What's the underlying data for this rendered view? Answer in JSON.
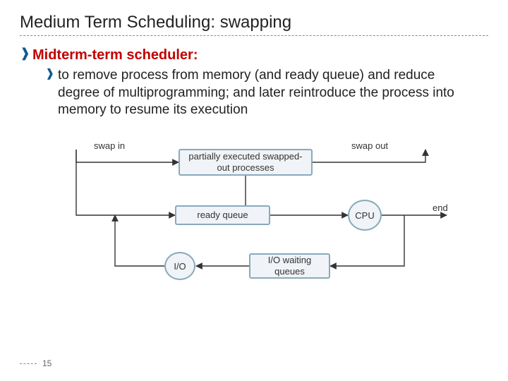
{
  "slide": {
    "title": "Medium Term Scheduling: swapping",
    "page_number": "15"
  },
  "bullets": {
    "main": "Midterm-term scheduler:",
    "sub": "to remove process from memory (and ready queue) and reduce degree of multiprogramming; and later reintroduce the process into memory to resume its execution"
  },
  "diagram": {
    "labels": {
      "swap_in": "swap in",
      "swap_out": "swap out",
      "swapped_box": "partially executed swapped-out processes",
      "ready_queue": "ready queue",
      "cpu": "CPU",
      "end": "end",
      "io": "I/O",
      "io_waiting": "I/O waiting queues"
    }
  }
}
